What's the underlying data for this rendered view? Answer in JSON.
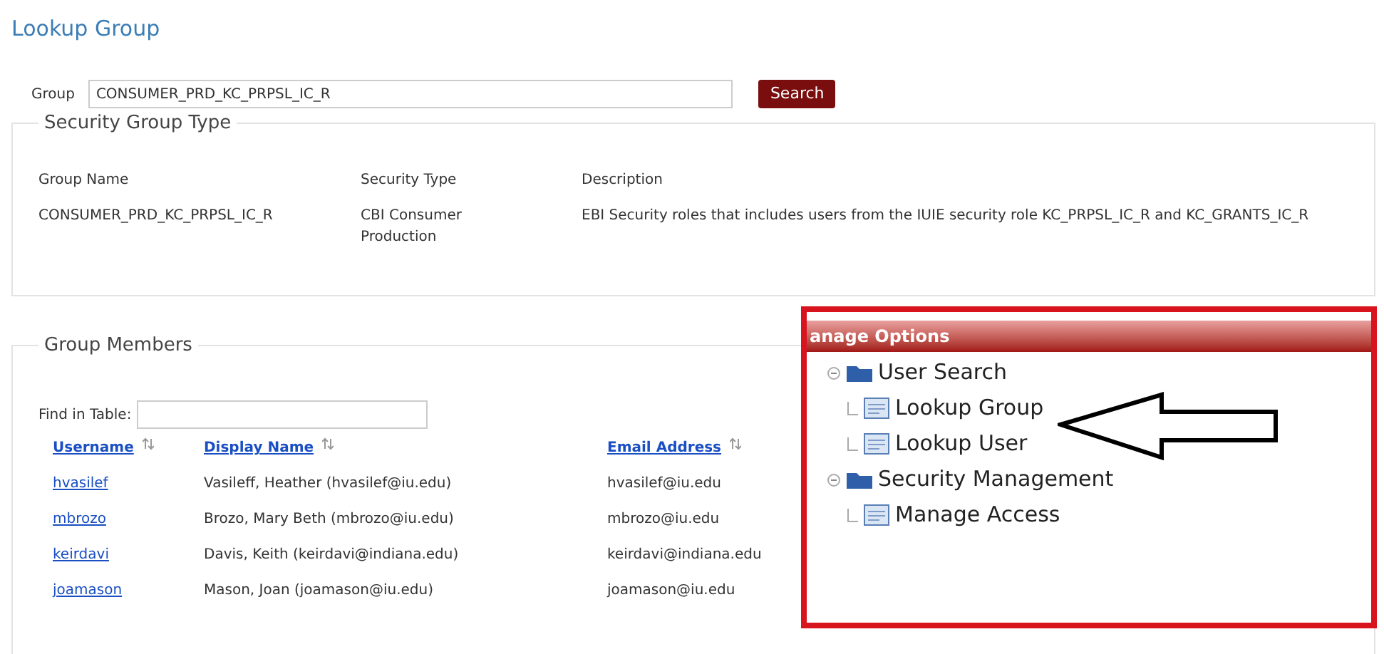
{
  "page_title": "Lookup Group",
  "search": {
    "label": "Group",
    "value": "CONSUMER_PRD_KC_PRPSL_IC_R",
    "button": "Search"
  },
  "security_group_type": {
    "legend": "Security Group Type",
    "columns": [
      "Group Name",
      "Security Type",
      "Description"
    ],
    "row": [
      "CONSUMER_PRD_KC_PRPSL_IC_R",
      "CBI Consumer Production",
      "EBI Security roles that includes users from the IUIE security role KC_PRPSL_IC_R and KC_GRANTS_IC_R"
    ]
  },
  "group_members": {
    "legend": "Group Members",
    "find_label": "Find in Table:",
    "columns": [
      "Username",
      "Display Name",
      "Email Address"
    ],
    "rows": [
      [
        "hvasilef",
        "Vasileff, Heather (hvasilef@iu.edu)",
        "hvasilef@iu.edu"
      ],
      [
        "mbrozo",
        "Brozo, Mary Beth (mbrozo@iu.edu)",
        "mbrozo@iu.edu"
      ],
      [
        "keirdavi",
        "Davis, Keith (keirdavi@indiana.edu)",
        "keirdavi@indiana.edu"
      ],
      [
        "joamason",
        "Mason, Joan (joamason@iu.edu)",
        "joamason@iu.edu"
      ]
    ]
  },
  "manage_options": {
    "title": "anage Options",
    "tree": [
      {
        "label": "User Search",
        "expanded": true,
        "children": [
          {
            "label": "Lookup Group"
          },
          {
            "label": "Lookup User"
          }
        ]
      },
      {
        "label": "Security Management",
        "expanded": true,
        "children": [
          {
            "label": "Manage Access"
          }
        ]
      }
    ]
  }
}
